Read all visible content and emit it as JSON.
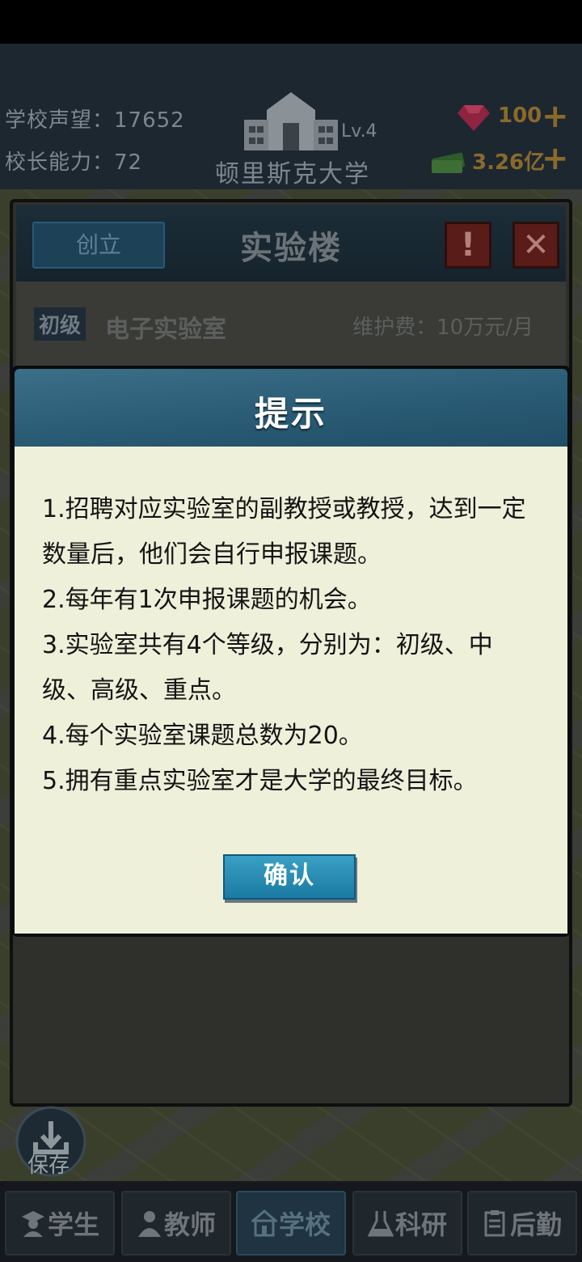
{
  "header": {
    "reputation_label": "学校声望：17652",
    "ability_label": "校长能力：72",
    "school_name": "顿里斯克大学",
    "school_level": "Lv.4",
    "gems": "100",
    "money": "3.26亿",
    "plus": "+"
  },
  "panel": {
    "found_button": "创立",
    "title": "实验楼",
    "alert_symbol": "!",
    "close_symbol": "✕",
    "lab_tier": "初级",
    "lab_name": "电子实验室",
    "lab_fee": "维护费：10万元/月"
  },
  "dialog": {
    "title": "提示",
    "lines": [
      "1.招聘对应实验室的副教授或教授，达到一定数量后，他们会自行申报课题。",
      "2.每年有1次申报课题的机会。",
      "3.实验室共有4个等级，分别为：初级、中级、高级、重点。",
      "4.每个实验室课题总数为20。",
      "5.拥有重点实验室才是大学的最终目标。"
    ],
    "confirm_label": "确认"
  },
  "save": {
    "label": "保存",
    "icon": "download-icon"
  },
  "nav": {
    "items": [
      {
        "label": "学生",
        "icon": "student-icon"
      },
      {
        "label": "教师",
        "icon": "teacher-icon"
      },
      {
        "label": "学校",
        "icon": "school-icon"
      },
      {
        "label": "科研",
        "icon": "flask-icon"
      },
      {
        "label": "后勤",
        "icon": "clipboard-icon"
      }
    ],
    "active_index": 2
  },
  "colors": {
    "dialog_header": "#2b5d76",
    "dialog_body": "#eff0da",
    "confirm_button": "#1a7aa2"
  }
}
